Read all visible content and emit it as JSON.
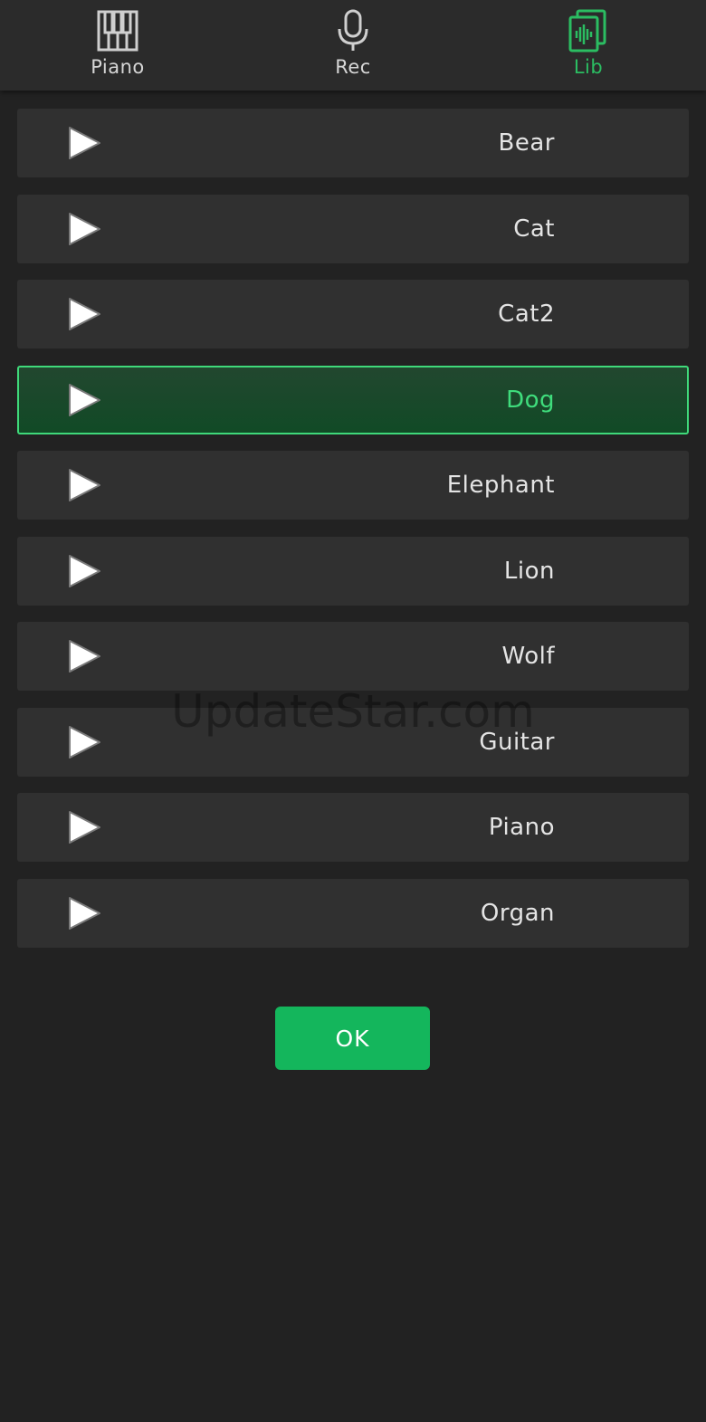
{
  "tabs": [
    {
      "label": "Piano",
      "icon": "piano-keys-icon"
    },
    {
      "label": "Rec",
      "icon": "microphone-icon"
    },
    {
      "label": "Lib",
      "icon": "audio-library-icon",
      "active": true
    }
  ],
  "sounds": [
    {
      "name": "Bear"
    },
    {
      "name": "Cat"
    },
    {
      "name": "Cat2"
    },
    {
      "name": "Dog",
      "selected": true
    },
    {
      "name": "Elephant"
    },
    {
      "name": "Lion"
    },
    {
      "name": "Wolf"
    },
    {
      "name": "Guitar"
    },
    {
      "name": "Piano"
    },
    {
      "name": "Organ"
    }
  ],
  "watermark": "UpdateStar.com",
  "ok_label": "OK",
  "colors": {
    "background": "#222222",
    "accent": "#2bbd62",
    "selected_border": "#3fd97a",
    "ok_button": "#14b65c"
  }
}
